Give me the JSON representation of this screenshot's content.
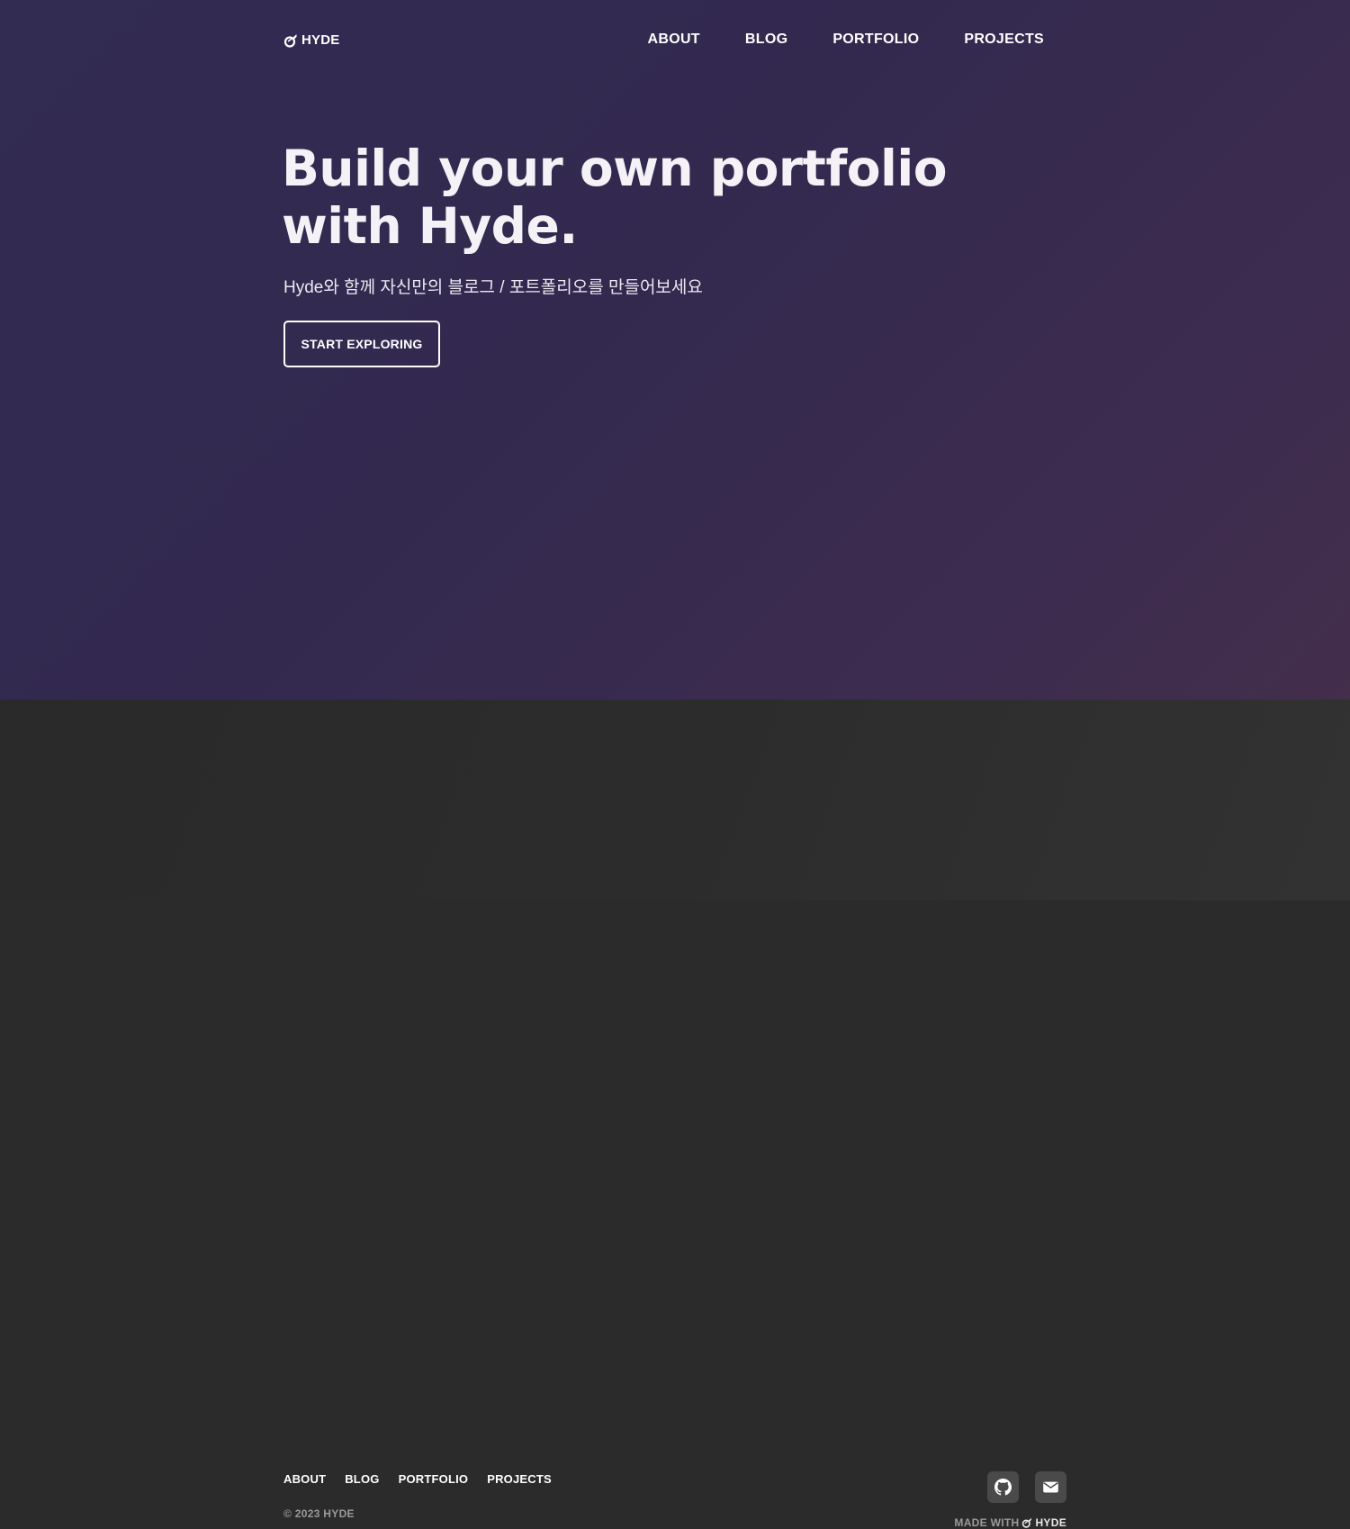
{
  "header": {
    "brand": "HYDE",
    "brand_icon": "hyde-logo-icon",
    "nav": [
      {
        "label": "ABOUT"
      },
      {
        "label": "BLOG"
      },
      {
        "label": "PORTFOLIO"
      },
      {
        "label": "PROJECTS"
      }
    ]
  },
  "hero": {
    "headline_line1": "Build your own portfolio",
    "headline_line2": "with Hyde.",
    "subtitle": "Hyde와 함께 자신만의 블로그 / 포트폴리오를 만들어보세요",
    "cta_label": "START EXPLORING"
  },
  "footer": {
    "nav": [
      {
        "label": "ABOUT"
      },
      {
        "label": "BLOG"
      },
      {
        "label": "PORTFOLIO"
      },
      {
        "label": "PROJECTS"
      }
    ],
    "copyright": "© 2023 HYDE",
    "social": [
      {
        "icon": "github-icon"
      },
      {
        "icon": "mail-icon"
      }
    ],
    "made_with_text": "MADE WITH",
    "made_with_brand": "HYDE"
  },
  "colors": {
    "hero_bg": "#332a50",
    "footer_bg": "#2c2c2c",
    "text": "#ffffff",
    "muted_text": "#9a9a9a",
    "social_btn_bg": "#4a4a4a"
  }
}
